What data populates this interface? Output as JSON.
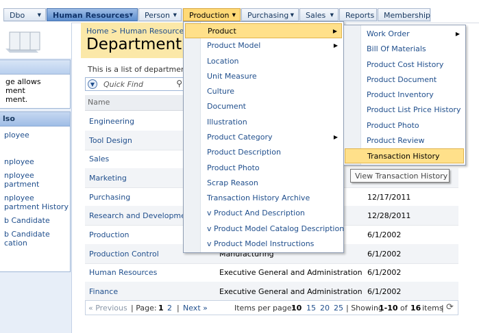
{
  "menubar": {
    "items": [
      {
        "label": "Dbo"
      },
      {
        "label": "Human Resources"
      },
      {
        "label": "Person"
      },
      {
        "label": "Production"
      },
      {
        "label": "Purchasing"
      },
      {
        "label": "Sales"
      },
      {
        "label": "Reports"
      },
      {
        "label": "Membership"
      }
    ]
  },
  "sidebar": {
    "about_text": [
      "ge allows",
      "ment",
      "ment."
    ],
    "see_also_title": "lso",
    "links": [
      "ployee",
      "nployee",
      "nployee",
      "partment",
      "nployee",
      "partment History",
      "b Candidate",
      "b Candidate",
      "cation"
    ]
  },
  "breadcrumb": {
    "home": "Home",
    "sep": ">",
    "section": "Human Resources",
    "sep2": ">"
  },
  "page": {
    "title": "Department",
    "description": "This is a list of department."
  },
  "search": {
    "placeholder": "Quick Find"
  },
  "grid": {
    "header": "Name",
    "rows": [
      {
        "name": "Engineering",
        "group": "",
        "date": ""
      },
      {
        "name": "Tool Design",
        "group": "",
        "date": ""
      },
      {
        "name": "Sales",
        "group": "",
        "date": ""
      },
      {
        "name": "Marketing",
        "group": "",
        "date": ""
      },
      {
        "name": "Purchasing",
        "group": "",
        "date": "12/17/2011"
      },
      {
        "name": "Research and Development",
        "group": "",
        "date": "12/28/2011"
      },
      {
        "name": "Production",
        "group": "",
        "date": "6/1/2002"
      },
      {
        "name": "Production Control",
        "group": "Manufacturing",
        "date": "6/1/2002"
      },
      {
        "name": "Human Resources",
        "group": "Executive General and Administration",
        "date": "6/1/2002"
      },
      {
        "name": "Finance",
        "group": "Executive General and Administration",
        "date": "6/1/2002"
      }
    ]
  },
  "pager": {
    "prev": "« Previous",
    "page_label": "| Page:",
    "page1": "1",
    "page2": "2",
    "sep": "|",
    "next": "Next »",
    "items_per_page": "Items per page:",
    "size1": "10",
    "size2": "15",
    "size3": "20",
    "size4": "25",
    "showing_prefix": "| Showing",
    "range": "1-10",
    "of": "of",
    "total": "16",
    "items_suffix": "items",
    "sep2": "|"
  },
  "production_menu": {
    "items": [
      "Product",
      "Product Model",
      "Location",
      "Unit Measure",
      "Culture",
      "Document",
      "Illustration",
      "Product Category",
      "Product Description",
      "Product Photo",
      "Scrap Reason",
      "Transaction History Archive",
      "v Product And Description",
      "v Product Model Catalog Description",
      "v Product Model Instructions"
    ]
  },
  "product_submenu": {
    "items": [
      "Work Order",
      "Bill Of Materials",
      "Product Cost History",
      "Product Document",
      "Product Inventory",
      "Product List Price History",
      "Product Photo",
      "Product Review",
      "Transaction History"
    ]
  },
  "tooltip": {
    "text": "View Transaction History"
  },
  "colors": {
    "accent": "#1f4e8c",
    "highlight": "#ffe08a",
    "title_bg": "#fbe8a8"
  }
}
